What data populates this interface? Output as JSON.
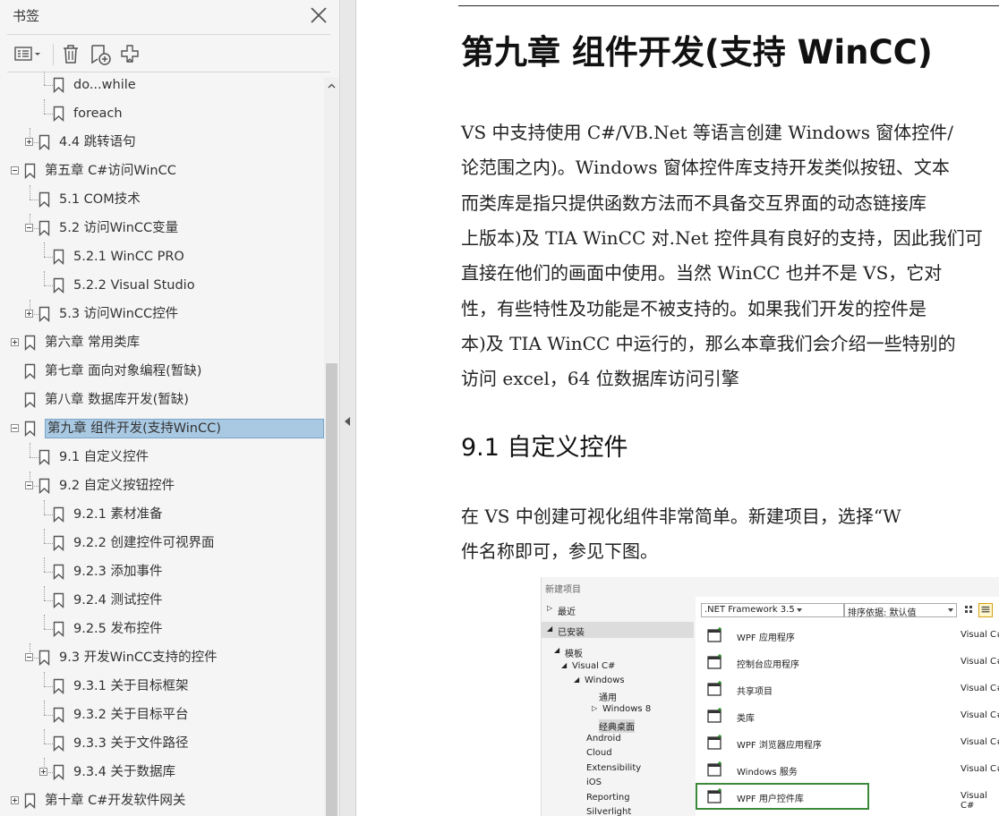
{
  "panel": {
    "title": "书签",
    "toolbar": [
      "options-menu",
      "delete",
      "new-bookmark",
      "expand-bookmark"
    ]
  },
  "tree": [
    {
      "label": "do...while",
      "level": 3,
      "expander": null
    },
    {
      "label": "foreach",
      "level": 3,
      "expander": null
    },
    {
      "label": "4.4 跳转语句",
      "level": 2,
      "expander": "plus"
    },
    {
      "label": "第五章 C#访问WinCC",
      "level": 1,
      "expander": "minus"
    },
    {
      "label": "5.1 COM技术",
      "level": 2,
      "expander": null
    },
    {
      "label": "5.2 访问WinCC变量",
      "level": 2,
      "expander": "minus"
    },
    {
      "label": "5.2.1 WinCC PRO",
      "level": 3,
      "expander": null
    },
    {
      "label": "5.2.2 Visual Studio",
      "level": 3,
      "expander": null
    },
    {
      "label": "5.3 访问WinCC控件",
      "level": 2,
      "expander": "plus"
    },
    {
      "label": "第六章 常用类库",
      "level": 1,
      "expander": "plus"
    },
    {
      "label": "第七章 面向对象编程(暂缺)",
      "level": 1,
      "expander": null
    },
    {
      "label": "第八章 数据库开发(暂缺)",
      "level": 1,
      "expander": null
    },
    {
      "label": "第九章 组件开发(支持WinCC)",
      "level": 1,
      "expander": "minus",
      "selected": true
    },
    {
      "label": "9.1 自定义控件",
      "level": 2,
      "expander": null
    },
    {
      "label": "9.2 自定义按钮控件",
      "level": 2,
      "expander": "minus"
    },
    {
      "label": "9.2.1 素材准备",
      "level": 3,
      "expander": null
    },
    {
      "label": "9.2.2 创建控件可视界面",
      "level": 3,
      "expander": null
    },
    {
      "label": "9.2.3 添加事件",
      "level": 3,
      "expander": null
    },
    {
      "label": "9.2.4 测试控件",
      "level": 3,
      "expander": null
    },
    {
      "label": "9.2.5 发布控件",
      "level": 3,
      "expander": null
    },
    {
      "label": "9.3 开发WinCC支持的控件",
      "level": 2,
      "expander": "minus"
    },
    {
      "label": "9.3.1 关于目标框架",
      "level": 3,
      "expander": null
    },
    {
      "label": "9.3.2 关于目标平台",
      "level": 3,
      "expander": null
    },
    {
      "label": "9.3.3 关于文件路径",
      "level": 3,
      "expander": null
    },
    {
      "label": "9.3.4 关于数据库",
      "level": 3,
      "expander": "plus"
    },
    {
      "label": "第十章 C#开发软件网关",
      "level": 1,
      "expander": "plus"
    }
  ],
  "doc": {
    "chapter_title": "第九章  组件开发(支持 WinCC)",
    "paragraph1": [
      "    VS 中支持使用 C#/VB.Net 等语言创建 Windows 窗体控件/",
      "论范围之内)。Windows  窗体控件库支持开发类似按钮、文本",
      "而类库是指只提供函数方法而不具备交互界面的动态链接库",
      "上版本)及 TIA WinCC 对.Net 控件具有良好的支持，因此我们可",
      "直接在他们的画面中使用。当然 WinCC 也并不是 VS，它对",
      "性，有些特性及功能是不被支持的。如果我们开发的控件是",
      "本)及 TIA WinCC 中运行的，那么本章我们会介绍一些特别的",
      "访问 excel，64 位数据库访问引擎"
    ],
    "section_title": "9.1  自定义控件",
    "paragraph2": [
      "    在 VS 中创建可视化组件非常简单。新建项目，选择“W",
      "件名称即可，参见下图。"
    ]
  },
  "new_project": {
    "title": "新建项目",
    "left_tree": [
      {
        "label": "最近",
        "indent": 0,
        "arrow": "▷"
      },
      {
        "label": "已安装",
        "indent": 0,
        "arrow": "◢",
        "highlight": true
      },
      {
        "label": "模板",
        "indent": 1,
        "arrow": "◢"
      },
      {
        "label": "Visual C#",
        "indent": 2,
        "arrow": "◢"
      },
      {
        "label": "Windows",
        "indent": 3,
        "arrow": "◢"
      },
      {
        "label": "通用",
        "indent": 4,
        "arrow": ""
      },
      {
        "label": "Windows 8",
        "indent": 4,
        "arrow": "▷"
      },
      {
        "label": "经典桌面",
        "indent": 4,
        "arrow": "",
        "highlight": true
      },
      {
        "label": "Android",
        "indent": 3,
        "arrow": ""
      },
      {
        "label": "Cloud",
        "indent": 3,
        "arrow": ""
      },
      {
        "label": "Extensibility",
        "indent": 3,
        "arrow": ""
      },
      {
        "label": "iOS",
        "indent": 3,
        "arrow": ""
      },
      {
        "label": "Reporting",
        "indent": 3,
        "arrow": ""
      },
      {
        "label": "Silverlight",
        "indent": 3,
        "arrow": ""
      }
    ],
    "framework": ".NET Framework 3.5",
    "sort_label": "排序依据:",
    "sort_value": "默认值",
    "templates": [
      {
        "name": "WPF 应用程序",
        "lang": "Visual C#"
      },
      {
        "name": "控制台应用程序",
        "lang": "Visual C#"
      },
      {
        "name": "共享项目",
        "lang": "Visual C#"
      },
      {
        "name": "类库",
        "lang": "Visual C#"
      },
      {
        "name": "WPF 浏览器应用程序",
        "lang": "Visual C#"
      },
      {
        "name": "Windows 服务",
        "lang": "Visual C#"
      },
      {
        "name": "WPF 用户控件库",
        "lang": "Visual C#",
        "boxed": true
      }
    ]
  },
  "colors": {
    "selection": "#a9c9e3",
    "green_box": "#3a8a3a"
  }
}
